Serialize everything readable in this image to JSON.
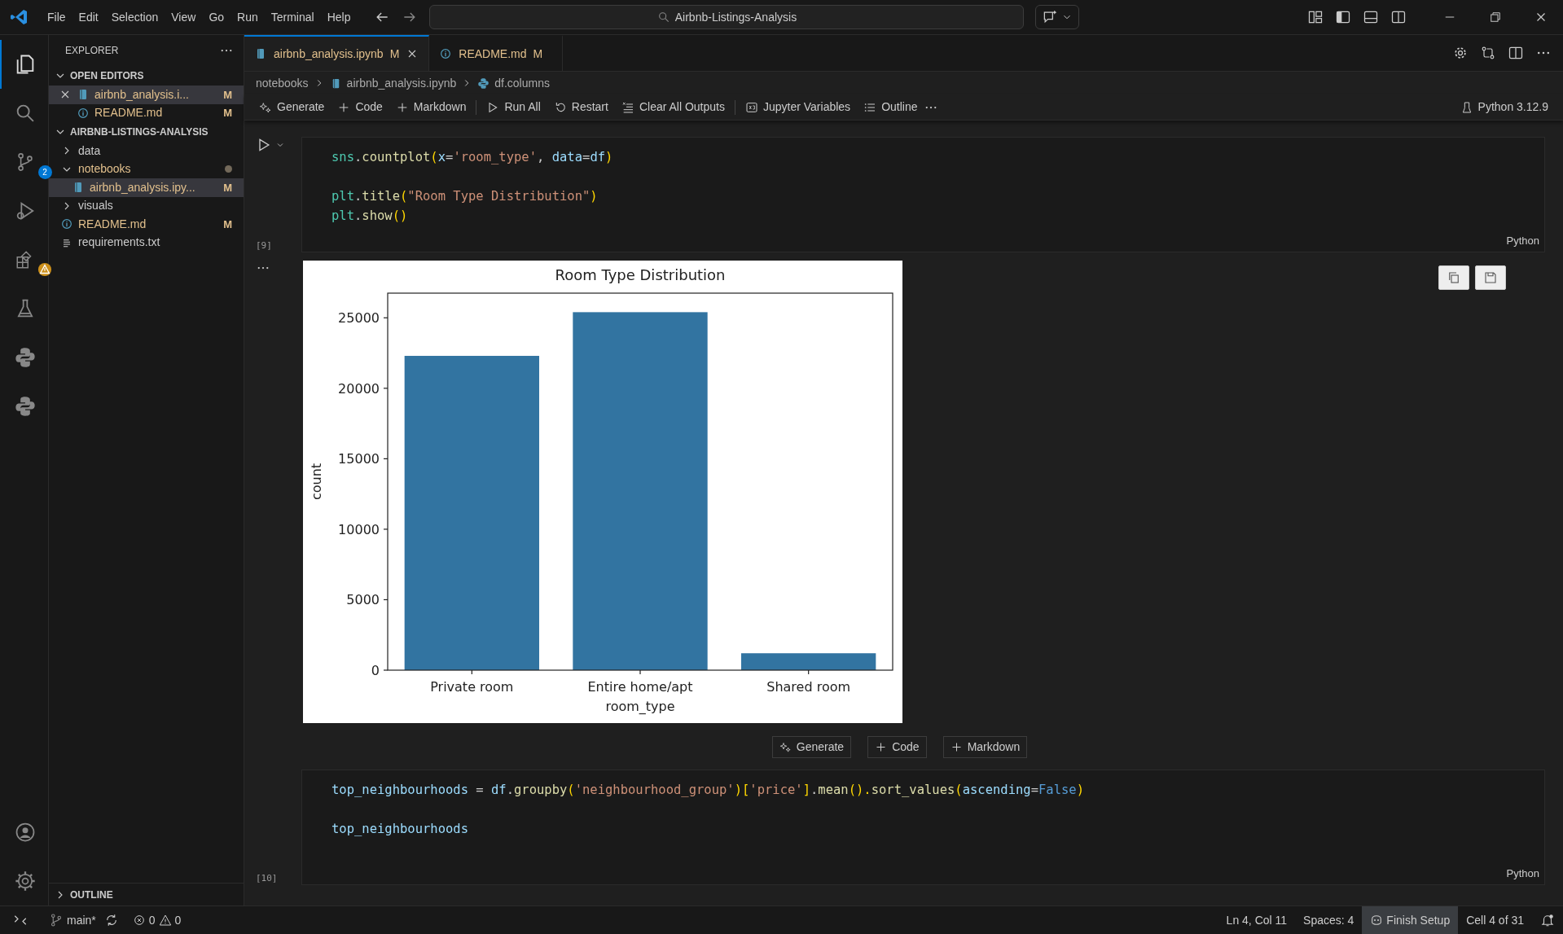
{
  "menu": [
    "File",
    "Edit",
    "Selection",
    "View",
    "Go",
    "Run",
    "Terminal",
    "Help"
  ],
  "command_center": {
    "value": "Airbnb-Listings-Analysis"
  },
  "activity_bar": [
    {
      "kind": "files",
      "selected": true
    },
    {
      "kind": "search",
      "selected": false
    },
    {
      "kind": "scm",
      "selected": false,
      "badge": "2"
    },
    {
      "kind": "debug",
      "selected": false
    },
    {
      "kind": "extensions",
      "selected": false,
      "warning": true
    },
    {
      "kind": "flask",
      "selected": false
    },
    {
      "kind": "snake",
      "selected": false
    },
    {
      "kind": "snake",
      "selected": false
    }
  ],
  "explorer": {
    "title": "EXPLORER",
    "open_editors": {
      "title": "OPEN EDITORS",
      "expanded": true,
      "items": [
        {
          "label": "airbnb_analysis.i...",
          "kind": "notebook",
          "badge": "M",
          "selected": true
        },
        {
          "label": "README.md",
          "kind": "info",
          "badge": "M",
          "selected": false
        }
      ]
    },
    "project": {
      "title": "AIRBNB-LISTINGS-ANALYSIS",
      "expanded": true,
      "children": [
        {
          "label": "data",
          "kind": "folder",
          "expanded": false,
          "modified": false,
          "selected": false
        },
        {
          "label": "notebooks",
          "kind": "folder",
          "expanded": true,
          "modified": true,
          "selected": false,
          "children": [
            {
              "label": "airbnb_analysis.ipy...",
              "kind": "notebook",
              "badge": "M",
              "selected": true
            }
          ]
        },
        {
          "label": "visuals",
          "kind": "folder",
          "expanded": false,
          "modified": false,
          "selected": false
        },
        {
          "label": "README.md",
          "kind": "info",
          "badge": "M",
          "selected": false
        },
        {
          "label": "requirements.txt",
          "kind": "text",
          "selected": false
        }
      ]
    },
    "outline": {
      "title": "OUTLINE",
      "expanded": false
    }
  },
  "tabs": [
    {
      "label": "airbnb_analysis.ipynb",
      "kind": "notebook",
      "badge": "M",
      "selected": true
    },
    {
      "label": "README.md",
      "kind": "info",
      "badge": "M",
      "selected": false
    }
  ],
  "breadcrumb": [
    {
      "label": "notebooks",
      "kind": "folder"
    },
    {
      "label": "airbnb_analysis.ipynb",
      "kind": "notebook"
    },
    {
      "label": "df.columns",
      "kind": "snake"
    }
  ],
  "toolbar": [
    {
      "label": "Generate",
      "kind": "sparkle",
      "divider_before": false
    },
    {
      "label": "Code",
      "kind": "plus",
      "divider_before": false
    },
    {
      "label": "Markdown",
      "kind": "plus",
      "divider_before": false
    },
    {
      "label": "Run All",
      "kind": "run",
      "divider_before": true
    },
    {
      "label": "Restart",
      "kind": "restart",
      "divider_before": false
    },
    {
      "label": "Clear All Outputs",
      "kind": "clear",
      "divider_before": false
    },
    {
      "label": "Jupyter Variables",
      "kind": "variables",
      "divider_before": true
    },
    {
      "label": "Outline",
      "kind": "list",
      "divider_before": false
    }
  ],
  "kernel": "Python 3.12.9",
  "cells": [
    {
      "kind": "code",
      "count": "[9]",
      "language": "Python",
      "lines": [
        {
          "kind": "code",
          "tokens": [
            {
              "text": "sns",
              "kind": "mod"
            },
            {
              "text": ".",
              "kind": "plain"
            },
            {
              "text": "countplot",
              "kind": "fn"
            },
            {
              "text": "(",
              "kind": "paren"
            },
            {
              "text": "x",
              "kind": "var"
            },
            {
              "text": "=",
              "kind": "plain"
            },
            {
              "text": "'room_type'",
              "kind": "str"
            },
            {
              "text": ", ",
              "kind": "plain"
            },
            {
              "text": "data",
              "kind": "var"
            },
            {
              "text": "=",
              "kind": "plain"
            },
            {
              "text": "df",
              "kind": "var"
            },
            {
              "text": ")",
              "kind": "paren"
            }
          ]
        },
        {
          "kind": "blank"
        },
        {
          "kind": "code",
          "tokens": [
            {
              "text": "plt",
              "kind": "mod"
            },
            {
              "text": ".",
              "kind": "plain"
            },
            {
              "text": "title",
              "kind": "fn"
            },
            {
              "text": "(",
              "kind": "paren"
            },
            {
              "text": "\"Room Type Distribution\"",
              "kind": "str"
            },
            {
              "text": ")",
              "kind": "paren"
            }
          ]
        },
        {
          "kind": "code",
          "tokens": [
            {
              "text": "plt",
              "kind": "mod"
            },
            {
              "text": ".",
              "kind": "plain"
            },
            {
              "text": "show",
              "kind": "fn"
            },
            {
              "text": "()",
              "kind": "paren"
            }
          ]
        }
      ]
    },
    {
      "kind": "chart_output",
      "chart_data": {
        "type": "bar",
        "title": "Room Type Distribution",
        "xlabel": "room_type",
        "ylabel": "count",
        "categories": [
          "Private room",
          "Entire home/apt",
          "Shared room"
        ],
        "series": [
          {
            "color": "#3274a1",
            "values": [
              22300,
              25400,
              1200
            ]
          }
        ],
        "ylim": [
          0,
          26750
        ],
        "yticks": [
          0,
          5000,
          10000,
          15000,
          20000,
          25000
        ]
      }
    },
    {
      "kind": "code",
      "count": "[10]",
      "language": "Python",
      "lines": [
        {
          "kind": "code",
          "tokens": [
            {
              "text": "top_neighbourhoods",
              "kind": "var"
            },
            {
              "text": " = ",
              "kind": "plain"
            },
            {
              "text": "df",
              "kind": "var"
            },
            {
              "text": ".",
              "kind": "plain"
            },
            {
              "text": "groupby",
              "kind": "fn"
            },
            {
              "text": "(",
              "kind": "paren"
            },
            {
              "text": "'neighbourhood_group'",
              "kind": "str"
            },
            {
              "text": ")",
              "kind": "paren"
            },
            {
              "text": "[",
              "kind": "paren"
            },
            {
              "text": "'price'",
              "kind": "str"
            },
            {
              "text": "]",
              "kind": "paren"
            },
            {
              "text": ".",
              "kind": "plain"
            },
            {
              "text": "mean",
              "kind": "fn"
            },
            {
              "text": "().",
              "kind": "paren"
            },
            {
              "text": "sort_values",
              "kind": "fn"
            },
            {
              "text": "(",
              "kind": "paren"
            },
            {
              "text": "ascending",
              "kind": "var"
            },
            {
              "text": "=",
              "kind": "plain"
            },
            {
              "text": "False",
              "kind": "kw"
            },
            {
              "text": ")",
              "kind": "paren"
            }
          ]
        },
        {
          "kind": "blank"
        },
        {
          "kind": "code",
          "tokens": [
            {
              "text": "top_neighbourhoods",
              "kind": "var"
            }
          ]
        }
      ]
    }
  ],
  "add_cell": [
    {
      "label": "Generate",
      "kind": "sparkle"
    },
    {
      "label": "Code",
      "kind": "plus"
    },
    {
      "label": "Markdown",
      "kind": "plus"
    }
  ],
  "status_bar": {
    "branch": "main*",
    "errors": "0",
    "warnings": "0",
    "position": "Ln 4, Col 11",
    "spaces": "Spaces: 4",
    "setup": "Finish Setup",
    "cell": "Cell 4 of 31"
  }
}
